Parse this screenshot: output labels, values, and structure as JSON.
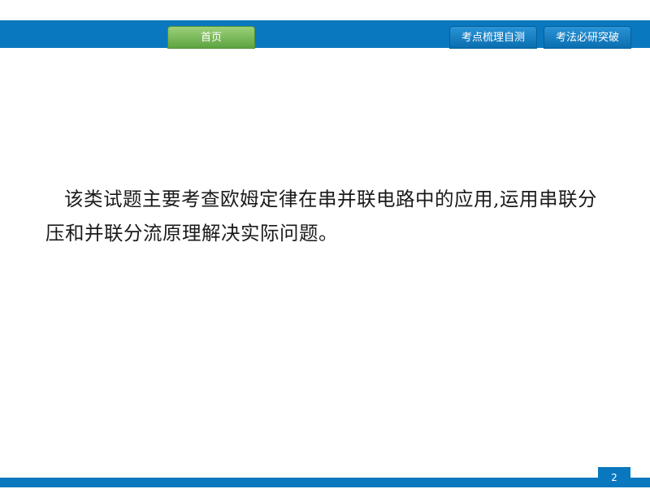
{
  "nav": {
    "home_label": "首页",
    "review_label": "考点梳理自测",
    "breakthrough_label": "考法必研突破"
  },
  "content": {
    "paragraph": "该类试题主要考查欧姆定律在串并联电路中的应用,运用串联分压和并联分流原理解决实际问题。"
  },
  "footer": {
    "page_number": "2"
  },
  "colors": {
    "primary_blue": "#0a78bf",
    "home_green": "#6db34c"
  }
}
